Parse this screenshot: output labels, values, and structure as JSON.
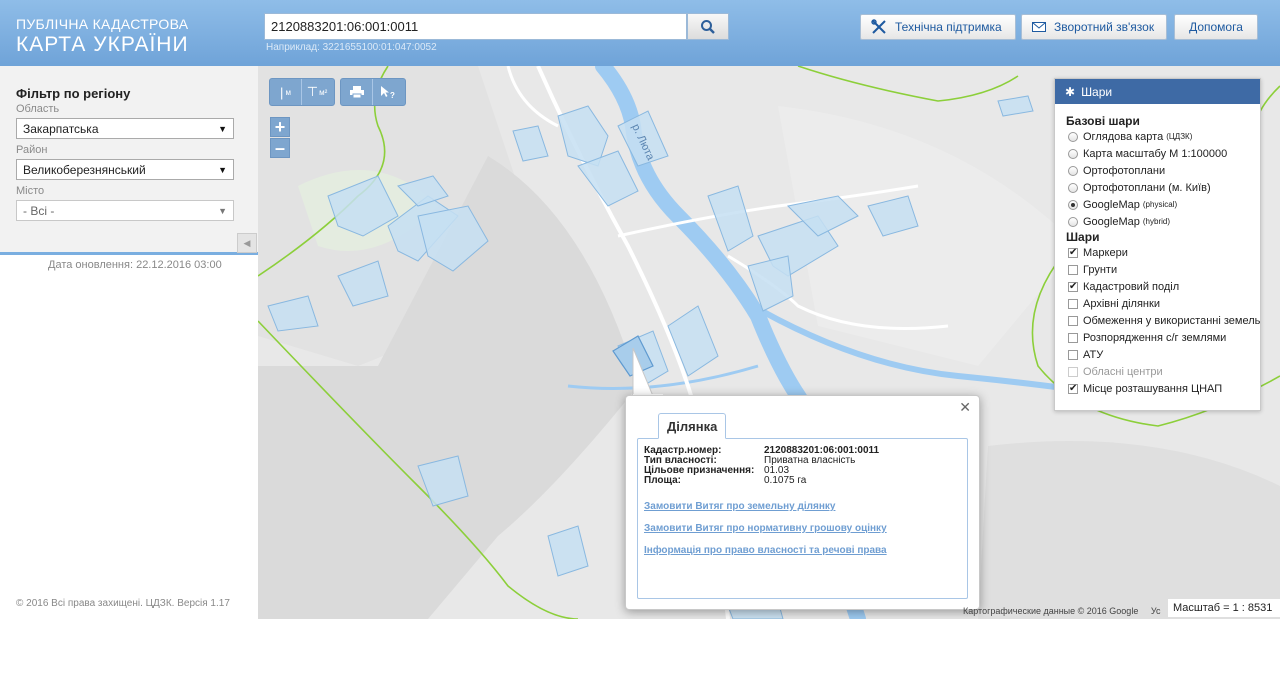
{
  "header": {
    "logo_line1": "ПУБЛІЧНА КАДАСТРОВА",
    "logo_line2": "КАРТА УКРАЇНИ",
    "search_value": "2120883201:06:001:0011",
    "search_hint": "Наприклад: 3221655100:01:047:0052",
    "support_label": "Технічна підтримка",
    "feedback_label": "Зворотний зв'язок",
    "help_label": "Допомога"
  },
  "filter": {
    "title": "Фільтр по регіону",
    "oblast_label": "Область",
    "oblast_value": "Закарпатська",
    "raion_label": "Район",
    "raion_value": "Великоберезнянський",
    "misto_label": "Місто",
    "misto_value": "- Всі -"
  },
  "update_date": "Дата оновлення: 22.12.2016 03:00",
  "footer_copy": "© 2016 Всі права захищені. ЦДЗК. Версія 1.17",
  "map": {
    "river_label": "р. Люта",
    "tool_ruler_sub": "м",
    "tool_area_sub": "м²",
    "zoom_in": "+",
    "zoom_out": "–",
    "attribution": "Картографические данные © 2016 Google",
    "attribution_cut": "Ус",
    "scale": "Масштаб = 1 : 8531"
  },
  "layers": {
    "title": "Шари",
    "base_title": "Базові шари",
    "base": [
      {
        "label": "Оглядова карта",
        "sup": "(ЦДЗК)",
        "on": false
      },
      {
        "label": "Карта масштабу М 1:100000",
        "sup": "",
        "on": false
      },
      {
        "label": "Ортофотоплани",
        "sup": "",
        "on": false
      },
      {
        "label": "Ортофотоплани (м. Київ)",
        "sup": "",
        "on": false
      },
      {
        "label": "GoogleMap",
        "sup": "(physical)",
        "on": true
      },
      {
        "label": "GoogleMap",
        "sup": "(hybrid)",
        "on": false
      }
    ],
    "overlay_title": "Шари",
    "overlays": [
      {
        "label": "Маркери",
        "checked": true,
        "disabled": false
      },
      {
        "label": "Грунти",
        "checked": false,
        "disabled": false
      },
      {
        "label": "Кадастровий поділ",
        "checked": true,
        "disabled": false
      },
      {
        "label": "Архівні ділянки",
        "checked": false,
        "disabled": false
      },
      {
        "label": "Обмеження у використанні земель",
        "checked": false,
        "disabled": false
      },
      {
        "label": "Розпорядження с/г землями",
        "checked": false,
        "disabled": false
      },
      {
        "label": "АТУ",
        "checked": false,
        "disabled": false
      },
      {
        "label": "Обласні центри",
        "checked": false,
        "disabled": true
      },
      {
        "label": "Місце розташування ЦНАП",
        "checked": true,
        "disabled": false
      }
    ]
  },
  "popup": {
    "tab": "Ділянка",
    "rows": [
      {
        "k": "Кадастр.номер:",
        "v": "2120883201:06:001:0011"
      },
      {
        "k": "Тип власності:",
        "v": "Приватна власність"
      },
      {
        "k": "Цільове призначення:",
        "v": "01.03"
      },
      {
        "k": "Площа:",
        "v": "0.1075 га"
      }
    ],
    "link1": "Замовити Витяг про земельну ділянку",
    "link2": "Замовити Витяг про нормативну грошову оцінку",
    "link3": "Інформація про право власності та речові права"
  },
  "colors": {
    "header": "#7aaee0",
    "river": "#9ecbf2",
    "parcel_fill": "#c5dff2",
    "parcel_stroke": "#89b8e0",
    "boundary": "#8ccf3a",
    "link": "#6f9ed2",
    "layers_head": "#3e6aa5"
  }
}
